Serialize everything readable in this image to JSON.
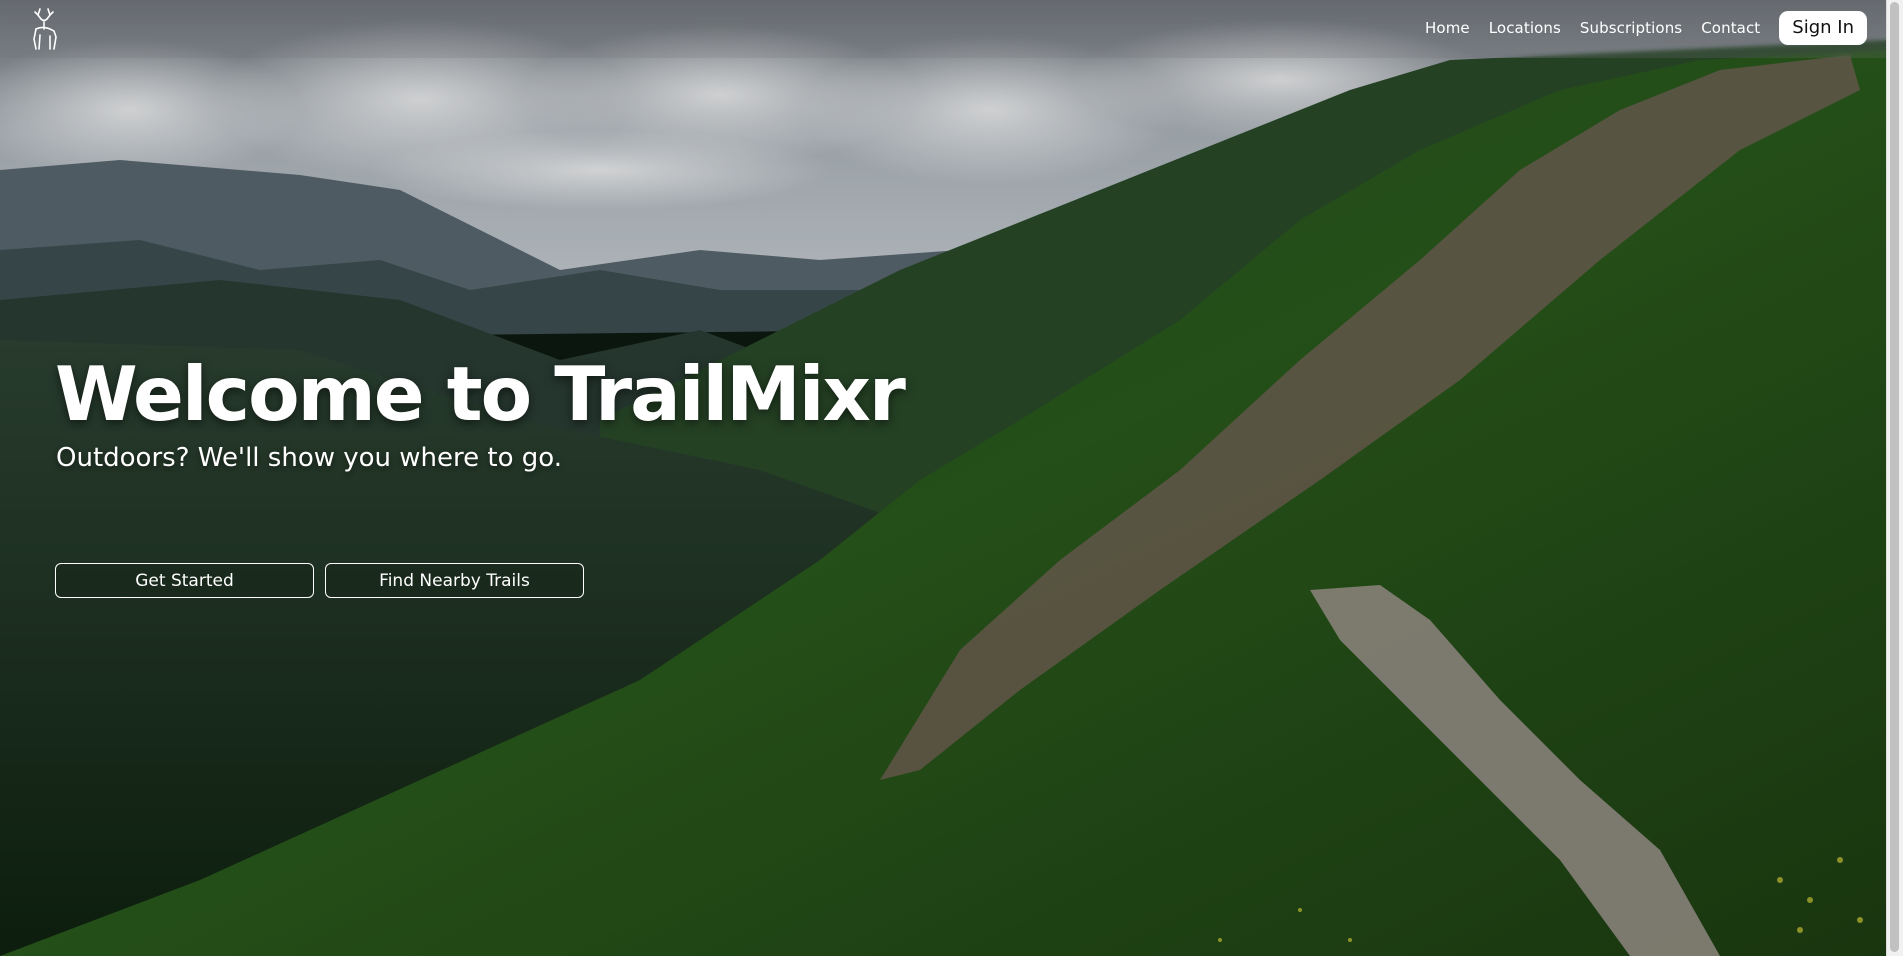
{
  "nav": {
    "logo_icon": "deer-logo-icon",
    "links": [
      "Home",
      "Locations",
      "Subscriptions",
      "Contact"
    ],
    "signin_label": "Sign In"
  },
  "hero": {
    "title": "Welcome to TrailMixr",
    "subtitle": "Outdoors? We'll show you where to go.",
    "buttons": [
      "Get Started",
      "Find Nearby Trails"
    ],
    "background": "mountain-valley-trail-photo"
  },
  "colors": {
    "nav_text": "#ffffff",
    "signin_bg": "#ffffff",
    "signin_text": "#111111"
  }
}
